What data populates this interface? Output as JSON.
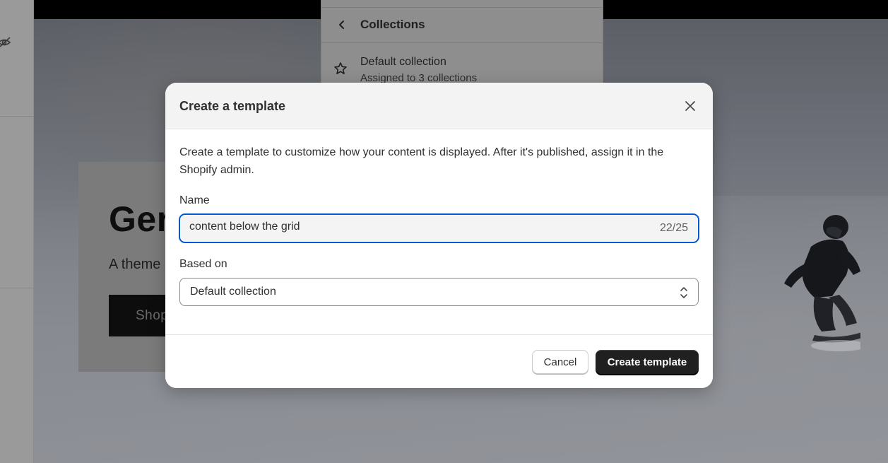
{
  "background": {
    "hero": {
      "title": "Ger",
      "subtitle": "A theme",
      "button_label": "Shop"
    },
    "template_panel": {
      "header_title": "Collections",
      "item": {
        "title": "Default collection",
        "subtitle": "Assigned to 3 collections"
      }
    }
  },
  "modal": {
    "title": "Create a template",
    "description": "Create a template to customize how your content is displayed. After it's published, assign it in the Shopify admin.",
    "name_field": {
      "label": "Name",
      "value": "content below the grid",
      "char_count": "22/25"
    },
    "based_on": {
      "label": "Based on",
      "selected": "Default collection"
    },
    "buttons": {
      "cancel": "Cancel",
      "create": "Create template"
    }
  },
  "icons": {
    "close": "close-icon",
    "back": "chevron-left-icon",
    "star": "star-icon",
    "select": "select-chevron-icon",
    "visibility": "eye-off-icon"
  },
  "colors": {
    "focus_border": "#005bd3",
    "primary_button": "#202020"
  }
}
